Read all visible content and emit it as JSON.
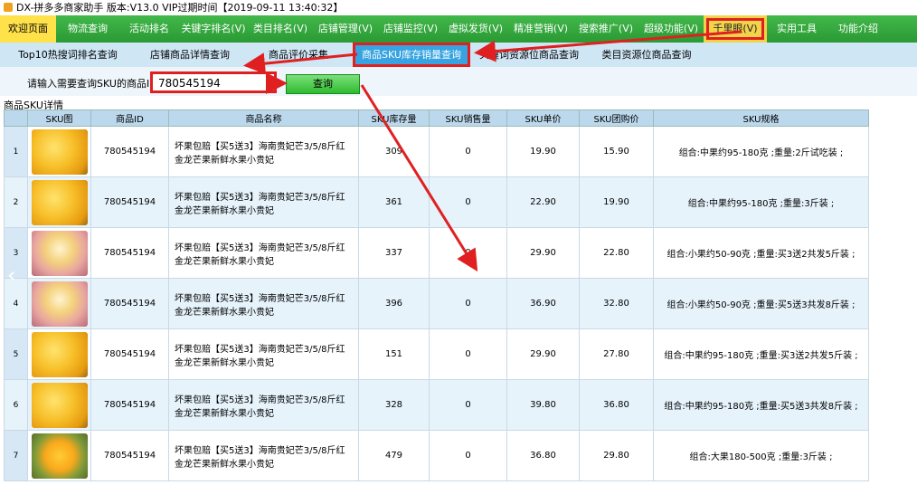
{
  "window": {
    "title": "DX-拼多多商家助手 版本:V13.0 VIP过期时间【2019-09-11 13:40:32】"
  },
  "menu": [
    {
      "label": "欢迎页面",
      "w": 62,
      "state": "active"
    },
    {
      "label": "物流查询",
      "w": 70
    },
    {
      "label": "活动排名",
      "w": 66
    },
    {
      "label": "关键字排名(V)",
      "w": 76
    },
    {
      "label": "类目排名(V)",
      "w": 72
    },
    {
      "label": "店铺管理(V)",
      "w": 72
    },
    {
      "label": "店铺监控(V)",
      "w": 72
    },
    {
      "label": "虚拟发货(V)",
      "w": 72
    },
    {
      "label": "精准营销(V)",
      "w": 72
    },
    {
      "label": "搜索推广(V)",
      "w": 72
    },
    {
      "label": "超级功能(V)",
      "w": 72
    },
    {
      "label": "千里眼(V)",
      "w": 70,
      "state": "highlight"
    },
    {
      "label": "实用工具",
      "w": 66
    },
    {
      "label": "功能介绍",
      "w": 70
    }
  ],
  "subnav": [
    {
      "label": "Top10热搜词排名查询",
      "w": 150
    },
    {
      "label": "店铺商品详情查询",
      "w": 120
    },
    {
      "label": "商品评价采集",
      "w": 120
    },
    {
      "label": "商品SKU库存销量查询",
      "w": 130,
      "state": "active"
    },
    {
      "label": "关键词资源位商品查询",
      "w": 130
    },
    {
      "label": "类目资源位商品查询",
      "w": 130
    }
  ],
  "query": {
    "label": "请输入需要查询SKU的商品ID",
    "value": "780545194",
    "button": "查询"
  },
  "section_title": "商品SKU详情",
  "table": {
    "columns": [
      "SKU图",
      "商品ID",
      "商品名称",
      "SKU库存量",
      "SKU销售量",
      "SKU单价",
      "SKU团购价",
      "SKU规格"
    ],
    "rows": [
      {
        "idx": "1",
        "img": "mango",
        "id": "780545194",
        "name": "坏果包赔【买5送3】海南贵妃芒3/5/8斤红金龙芒果新鲜水果小贵妃",
        "stock": "309",
        "sales": "0",
        "price": "19.90",
        "group": "15.90",
        "spec": "组合:中果约95-180克 ;重量:2斤试吃装 ;"
      },
      {
        "idx": "2",
        "img": "mango",
        "id": "780545194",
        "name": "坏果包赔【买5送3】海南贵妃芒3/5/8斤红金龙芒果新鲜水果小贵妃",
        "stock": "361",
        "sales": "0",
        "price": "22.90",
        "group": "19.90",
        "spec": "组合:中果约95-180克 ;重量:3斤装 ;"
      },
      {
        "idx": "3",
        "img": "mango-pink",
        "id": "780545194",
        "name": "坏果包赔【买5送3】海南贵妃芒3/5/8斤红金龙芒果新鲜水果小贵妃",
        "stock": "337",
        "sales": "0",
        "price": "29.90",
        "group": "22.80",
        "spec": "组合:小果约50-90克 ;重量:买3送2共发5斤装 ;"
      },
      {
        "idx": "4",
        "img": "mango-pink",
        "id": "780545194",
        "name": "坏果包赔【买5送3】海南贵妃芒3/5/8斤红金龙芒果新鲜水果小贵妃",
        "stock": "396",
        "sales": "0",
        "price": "36.90",
        "group": "32.80",
        "spec": "组合:小果约50-90克 ;重量:买5送3共发8斤装 ;"
      },
      {
        "idx": "5",
        "img": "mango",
        "id": "780545194",
        "name": "坏果包赔【买5送3】海南贵妃芒3/5/8斤红金龙芒果新鲜水果小贵妃",
        "stock": "151",
        "sales": "0",
        "price": "29.90",
        "group": "27.80",
        "spec": "组合:中果约95-180克 ;重量:买3送2共发5斤装 ;"
      },
      {
        "idx": "6",
        "img": "mango",
        "id": "780545194",
        "name": "坏果包赔【买5送3】海南贵妃芒3/5/8斤红金龙芒果新鲜水果小贵妃",
        "stock": "328",
        "sales": "0",
        "price": "39.80",
        "group": "36.80",
        "spec": "组合:中果约95-180克 ;重量:买5送3共发8斤装 ;"
      },
      {
        "idx": "7",
        "img": "mango-cut",
        "id": "780545194",
        "name": "坏果包赔【买5送3】海南贵妃芒3/5/8斤红金龙芒果新鲜水果小贵妃",
        "stock": "479",
        "sales": "0",
        "price": "36.80",
        "group": "29.80",
        "spec": "组合:大果180-500克 ;重量:3斤装 ;"
      }
    ]
  }
}
